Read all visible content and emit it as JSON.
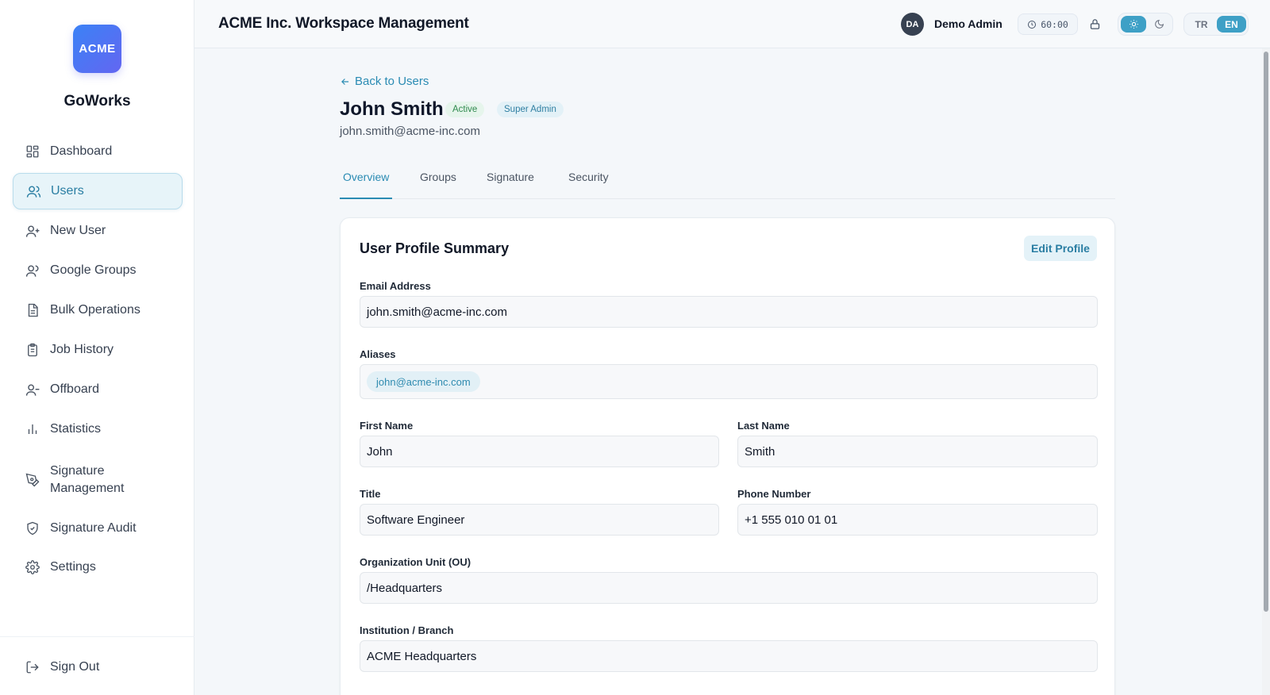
{
  "app": {
    "title": "ACME Inc. Workspace Management",
    "logo_text": "ACME",
    "brand": "GoWorks"
  },
  "sidebar": {
    "items": [
      {
        "label": "Dashboard",
        "icon": "dashboard-icon"
      },
      {
        "label": "Users",
        "icon": "users-icon",
        "active": true
      },
      {
        "label": "New User",
        "icon": "user-plus-icon"
      },
      {
        "label": "Google Groups",
        "icon": "group-icon"
      },
      {
        "label": "Bulk Operations",
        "icon": "file-stack-icon"
      },
      {
        "label": "Job History",
        "icon": "clipboard-icon"
      },
      {
        "label": "Offboard",
        "icon": "user-minus-icon"
      },
      {
        "label": "Statistics",
        "icon": "bar-chart-icon"
      },
      {
        "label": "Signature Management",
        "icon": "pen-tool-icon"
      },
      {
        "label": "Signature Audit",
        "icon": "shield-check-icon"
      },
      {
        "label": "Settings",
        "icon": "gear-icon"
      }
    ],
    "signout": "Sign Out"
  },
  "header": {
    "avatar_initials": "DA",
    "user_name": "Demo Admin",
    "timer": "60:00",
    "lang": {
      "tr": "TR",
      "en": "EN",
      "selected": "EN"
    },
    "theme_selected": "light"
  },
  "page": {
    "back_label": "Back to Users",
    "user_name": "John Smith",
    "status_badge": "Active",
    "role_badge": "Super Admin",
    "email": "john.smith@acme-inc.com",
    "tabs": [
      "Overview",
      "Groups",
      "Signature",
      "Security"
    ],
    "active_tab": "Overview"
  },
  "profile": {
    "title": "User Profile Summary",
    "edit_label": "Edit Profile",
    "email_label": "Email Address",
    "email_value": "john.smith@acme-inc.com",
    "aliases_label": "Aliases",
    "aliases": [
      "john@acme-inc.com"
    ],
    "first_name_label": "First Name",
    "first_name_value": "John",
    "last_name_label": "Last Name",
    "last_name_value": "Smith",
    "title_label": "Title",
    "title_value": "Software Engineer",
    "phone_label": "Phone Number",
    "phone_value": "+1 555 010 01 01",
    "ou_label": "Organization Unit (OU)",
    "ou_value": "/Headquarters",
    "institution_label": "Institution / Branch",
    "institution_value": "ACME Headquarters"
  },
  "colors": {
    "accent": "#2a8bb3",
    "logo_gradient_start": "#3b82f6",
    "logo_gradient_end": "#6366f1",
    "active_badge": "#2f8a4e"
  }
}
